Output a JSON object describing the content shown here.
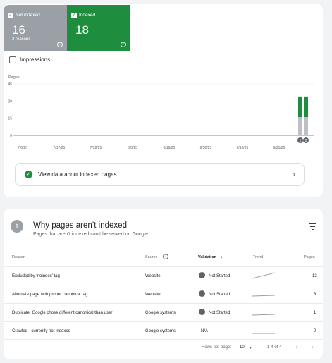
{
  "tiles": {
    "not_indexed": {
      "label": "Not indexed",
      "count": "16",
      "sub": "3 reasons"
    },
    "indexed": {
      "label": "Indexed",
      "count": "18"
    },
    "help_glyph": "?"
  },
  "impressions_label": "Impressions",
  "chart_data": {
    "type": "bar",
    "ylabel": "Pages",
    "y_ticks": [
      "45",
      "30",
      "15",
      "0"
    ],
    "ylim": [
      0,
      45
    ],
    "x_ticks": [
      "7/6/25",
      "7/17/25",
      "7/28/25",
      "8/8/25",
      "8/19/25",
      "8/30/25",
      "9/10/25",
      "9/21/25"
    ],
    "grid": true,
    "series": [
      {
        "name": "Not indexed",
        "color": "#bdc1c6",
        "values": [
          16,
          16
        ]
      },
      {
        "name": "Indexed",
        "color": "#1e8e3e",
        "values": [
          18,
          18
        ]
      }
    ],
    "annotations": [
      "1",
      "2"
    ]
  },
  "view_data": {
    "label": "View data about indexed pages"
  },
  "why": {
    "title": "Why pages aren’t indexed",
    "subtitle": "Pages that aren’t indexed can’t be served on Google"
  },
  "table": {
    "headers": {
      "reason": "Reason",
      "source": "Source",
      "validation": "Validation",
      "trend": "Trend",
      "pages": "Pages"
    },
    "sort_glyph": "↓",
    "rows": [
      {
        "reason": "Excluded by ‘noindex’ tag",
        "source": "Website",
        "validation": "Not Started",
        "pages": "12"
      },
      {
        "reason": "Alternate page with proper canonical tag",
        "source": "Website",
        "validation": "Not Started",
        "pages": "3"
      },
      {
        "reason": "Duplicate, Google chose different canonical than user",
        "source": "Google systems",
        "validation": "Not Started",
        "pages": "1"
      },
      {
        "reason": "Crawled - currently not indexed",
        "source": "Google systems",
        "validation": "N/A",
        "pages": "0"
      }
    ]
  },
  "footer": {
    "rows_per_page_label": "Rows per page:",
    "rows_per_page_value": "10",
    "range": "1-4 of 4"
  },
  "colors": {
    "not_indexed": "#9aa0a6",
    "indexed": "#1e8e3e",
    "badge": "#5f6368"
  },
  "icons": {
    "checkbox": "checkbox-checked-icon",
    "help": "help-circle-icon",
    "check": "check-circle-icon",
    "chevron": "chevron-right-icon",
    "info": "info-icon",
    "filter": "filter-icon",
    "warning": "warning-icon"
  }
}
